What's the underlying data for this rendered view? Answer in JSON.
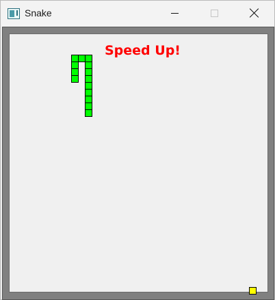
{
  "window": {
    "title": "Snake",
    "icon": "snake-app-icon",
    "controls": [
      "minimize-icon",
      "maximize-icon",
      "close-icon"
    ]
  },
  "game": {
    "message": "Speed Up!",
    "colors": {
      "snake": "#00ff00",
      "food": "#ffff00",
      "message": "#ff0000",
      "wall": "#808080",
      "background": "#f0f0f0"
    },
    "grid_cell_size": 10,
    "snake_cells": [
      [
        9,
        3
      ],
      [
        9,
        4
      ],
      [
        9,
        5
      ],
      [
        9,
        6
      ],
      [
        10,
        3
      ],
      [
        11,
        3
      ],
      [
        11,
        4
      ],
      [
        11,
        5
      ],
      [
        11,
        6
      ],
      [
        11,
        7
      ],
      [
        11,
        8
      ],
      [
        11,
        9
      ],
      [
        11,
        10
      ],
      [
        11,
        11
      ]
    ],
    "food_cell": [
      35,
      37
    ]
  }
}
